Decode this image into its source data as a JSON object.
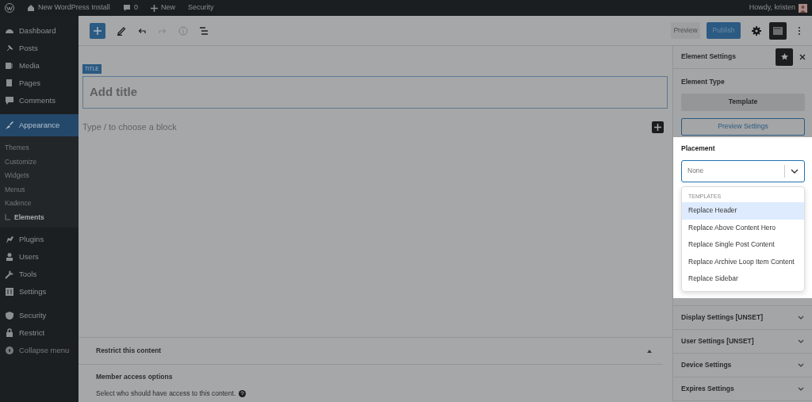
{
  "admin_bar": {
    "site": "New WordPress Install",
    "comments": "0",
    "new": "New",
    "security": "Security",
    "greeting": "Howdy, kristen"
  },
  "sidebar": {
    "items": [
      {
        "label": "Dashboard",
        "selected": false
      },
      {
        "label": "Posts",
        "selected": false
      },
      {
        "label": "Media",
        "selected": false
      },
      {
        "label": "Pages",
        "selected": false
      },
      {
        "label": "Comments",
        "selected": false
      },
      {
        "label": "Appearance",
        "selected": true,
        "children": [
          {
            "label": "Themes",
            "selected": false
          },
          {
            "label": "Customize",
            "selected": false
          },
          {
            "label": "Widgets",
            "selected": false
          },
          {
            "label": "Menus",
            "selected": false
          },
          {
            "label": "Kadence",
            "selected": false
          },
          {
            "label": "Elements",
            "selected": true
          }
        ]
      },
      {
        "label": "Plugins",
        "selected": false
      },
      {
        "label": "Users",
        "selected": false
      },
      {
        "label": "Tools",
        "selected": false
      },
      {
        "label": "Settings",
        "selected": false
      },
      {
        "label": "Security",
        "selected": false
      },
      {
        "label": "Restrict",
        "selected": false
      },
      {
        "label": "Collapse menu",
        "selected": false
      }
    ]
  },
  "toolbar": {
    "preview": "Preview",
    "publish": "Publish"
  },
  "editor": {
    "title_tag": "TITLE",
    "title_placeholder": "Add title",
    "block_placeholder": "Type / to choose a block"
  },
  "meta_box": {
    "title": "Restrict this content",
    "expanded": true,
    "heading": "Member access options",
    "text": "Select who should have access to this content."
  },
  "settings_panel": {
    "title": "Element Settings",
    "element_type_label": "Element Type",
    "element_type": "Template",
    "preview_settings": "Preview Settings",
    "placement": {
      "label": "Placement",
      "placeholder": "None",
      "group": "TEMPLATES",
      "options": [
        {
          "label": "Replace Header",
          "selected": true
        },
        {
          "label": "Replace Above Content Hero",
          "selected": false
        },
        {
          "label": "Replace Single Post Content",
          "selected": false
        },
        {
          "label": "Replace Archive Loop Item Content",
          "selected": false
        },
        {
          "label": "Replace Sidebar",
          "selected": false
        }
      ]
    },
    "sections": [
      {
        "label": "Display Settings [UNSET]",
        "expanded": false
      },
      {
        "label": "User Settings [UNSET]",
        "expanded": false
      },
      {
        "label": "Device Settings",
        "expanded": false
      },
      {
        "label": "Expires Settings",
        "expanded": false
      }
    ]
  }
}
